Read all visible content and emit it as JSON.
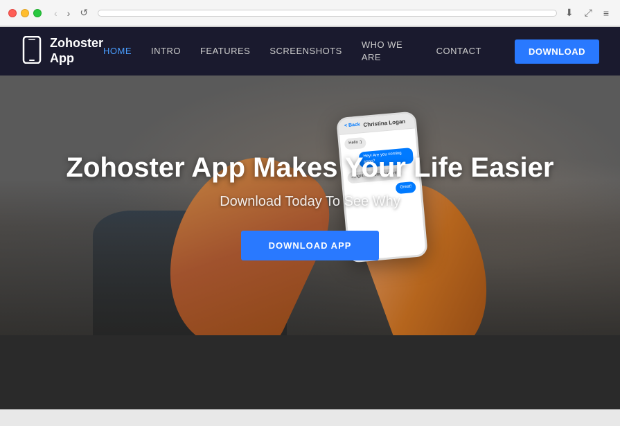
{
  "browser": {
    "traffic_lights": [
      "red",
      "yellow",
      "green"
    ],
    "nav": {
      "back_label": "‹",
      "forward_label": "›",
      "refresh_label": "↺"
    },
    "address": "",
    "actions": {
      "download_icon": "⬇",
      "fullscreen_icon": "⤢",
      "menu_icon": "≡"
    }
  },
  "navbar": {
    "brand": {
      "icon": "📱",
      "name_line1": "Zohoster",
      "name_line2": "App"
    },
    "links": [
      {
        "label": "HOME",
        "active": true
      },
      {
        "label": "INTRO",
        "active": false
      },
      {
        "label": "FEATURES",
        "active": false
      },
      {
        "label": "SCREENSHOTS",
        "active": false
      },
      {
        "label": "WHO WE ARE",
        "active": false
      },
      {
        "label": "CONTACT",
        "active": false
      }
    ],
    "download_label": "DOWNLOAD"
  },
  "hero": {
    "title": "Zohoster App Makes Your Life Easier",
    "subtitle": "Download Today To See Why",
    "cta_label": "DOWNLOAD APP",
    "phone": {
      "back_label": "< Back",
      "contact_name": "Christina Logan",
      "bubbles": [
        {
          "type": "received",
          "text": "Hello :)"
        },
        {
          "type": "sent",
          "text": "Hey! Are you coming soon?"
        },
        {
          "type": "received",
          "text": "Alright, I'm coming soon!"
        },
        {
          "type": "sent",
          "text": "Great!"
        }
      ]
    }
  },
  "footer": {
    "background_color": "#2a2a2a"
  }
}
